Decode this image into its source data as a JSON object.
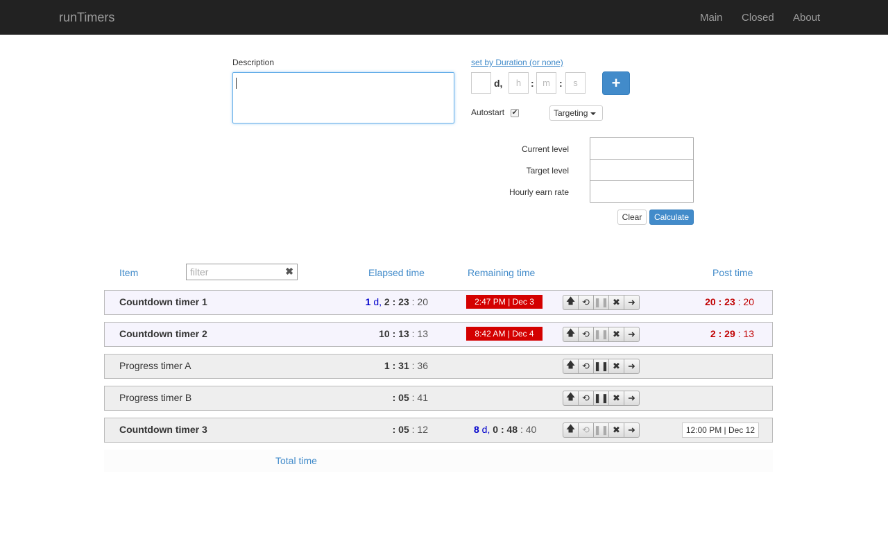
{
  "app": {
    "title": "runTimers"
  },
  "nav": {
    "main": "Main",
    "closed": "Closed",
    "about": "About"
  },
  "form": {
    "description_label": "Description",
    "description_value": "",
    "duration_link": "set by Duration (or none)",
    "days_placeholder": "",
    "days_suffix": "d,",
    "hours_placeholder": "h",
    "minutes_placeholder": "m",
    "seconds_placeholder": "s",
    "sep": ":",
    "add_icon": "+",
    "autostart_label": "Autostart",
    "autostart_checked": true,
    "targeting_label": "Targeting",
    "current_level_label": "Current level",
    "target_level_label": "Target level",
    "hourly_rate_label": "Hourly earn rate",
    "clear_label": "Clear",
    "calculate_label": "Calculate"
  },
  "table": {
    "headers": {
      "item": "Item",
      "elapsed": "Elapsed time",
      "remaining": "Remaining time",
      "post": "Post time"
    },
    "filter_placeholder": "filter",
    "filter_clear_icon": "✖",
    "rows": [
      {
        "name": "Countdown timer 1",
        "elapsed": {
          "d": "1",
          "dsep": " d, ",
          "h": "2",
          "m": "23",
          "s": "20"
        },
        "remaining_badge": "2:47 PM | Dec 3",
        "post": {
          "h": "20",
          "m": "23",
          "s": "20"
        }
      },
      {
        "name": "Countdown timer 2",
        "elapsed": {
          "h": "10",
          "m": "13",
          "s": "13"
        },
        "remaining_badge": "8:42 AM | Dec 4",
        "post": {
          "h": "2",
          "m": "29",
          "s": "13"
        }
      },
      {
        "name": "Progress timer A",
        "elapsed": {
          "h": "1",
          "m": "31",
          "s": "36"
        }
      },
      {
        "name": "Progress timer B",
        "elapsed": {
          "m": "05",
          "s": "41"
        }
      },
      {
        "name": "Countdown timer 3",
        "elapsed": {
          "m": "05",
          "s": "12"
        },
        "remaining": {
          "d": "8",
          "dsep": " d, ",
          "h": "0",
          "m": "48",
          "s": "40"
        },
        "post_badge": "12:00 PM | Dec 12"
      }
    ],
    "total_label": "Total time"
  },
  "icons": {
    "up": "🡅",
    "repeat": "⟲",
    "pause": "❚❚",
    "close": "✖",
    "next": "➜"
  },
  "colors": {
    "navbar": "#222222",
    "accent": "#428bca",
    "badge_red": "#d40000",
    "countdown_bg": "#f6f4fd",
    "progress_bg": "#eeeeee"
  }
}
